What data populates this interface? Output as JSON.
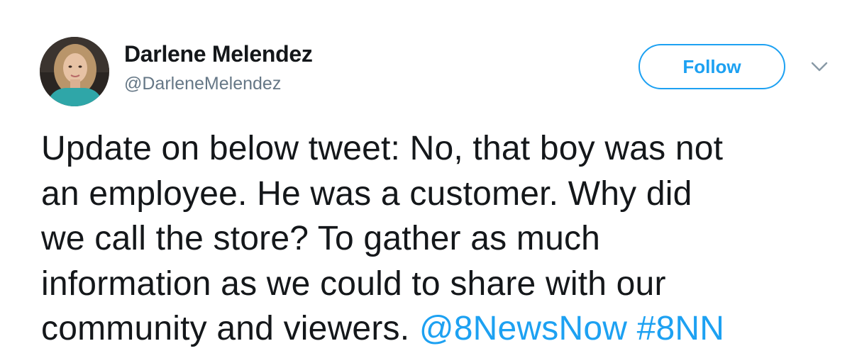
{
  "author": {
    "display_name": "Darlene Melendez",
    "handle": "@DarleneMelendez"
  },
  "follow_button": {
    "label": "Follow"
  },
  "tweet": {
    "lines": [
      "Update on below tweet: No, that boy was not",
      "an employee. He was a customer. Why did",
      "we call the store? To gather as much",
      "information as we could to share with our",
      "community and viewers."
    ],
    "mention": "@8NewsNow",
    "hashtag": "#8NN"
  },
  "colors": {
    "accent": "#1da1f2",
    "text": "#14171a",
    "secondary_text": "#657786"
  },
  "icons": {
    "caret": "chevron-down-icon",
    "avatar": "profile-photo"
  }
}
